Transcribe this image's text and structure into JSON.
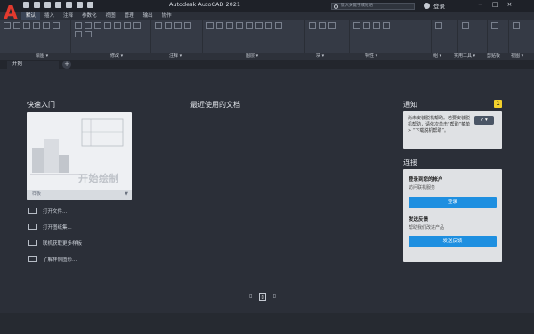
{
  "app": {
    "title": "Autodesk AutoCAD 2021",
    "logo_letter": "A"
  },
  "topbar": {
    "search_placeholder": "键入关键字或短语",
    "login_label": "登录",
    "window_controls": [
      "−",
      "□",
      "×"
    ]
  },
  "menu": {
    "items": [
      "默认",
      "插入",
      "注释",
      "参数化",
      "视图",
      "管理",
      "输出",
      "协作"
    ],
    "active_index": 0
  },
  "ribbon": {
    "group_labels": [
      "绘图 ▾",
      "修改 ▾",
      "注释 ▾",
      "图层 ▾",
      "块 ▾",
      "特性 ▾",
      "组 ▾",
      "实用工具 ▾",
      "剪贴板",
      "视图 ▾"
    ]
  },
  "tabs": {
    "start_label": "开始",
    "plus_label": "+"
  },
  "quick_start": {
    "title": "快速入门",
    "hero_text": "开始绘制",
    "template_label": "样板",
    "links": [
      "打开文件...",
      "打开图纸集...",
      "联机获取更多样板",
      "了解样例图形..."
    ]
  },
  "recent": {
    "title": "最近使用的文档"
  },
  "notifications": {
    "title": "通知",
    "badge": "1",
    "message": "尚未安装脱机帮助。若要安装脱机帮助，请依次单击“帮助”菜单 > “下载脱机帮助”。",
    "help_button": "? ▾"
  },
  "connect": {
    "title": "连接",
    "login_title": "登录到您的帐户",
    "login_sub": "访问联机服务",
    "login_button": "登录",
    "feedback_title": "发送反馈",
    "feedback_sub": "帮助我们改进产品",
    "feedback_button": "发送反馈"
  },
  "pager": {
    "items": [
      "▯",
      "▯",
      "▯"
    ],
    "active_index": 1
  },
  "colors": {
    "background": "#2b2f38",
    "accent": "#1e8fe0",
    "badge": "#f3d12c",
    "logo": "#e23a2e"
  }
}
